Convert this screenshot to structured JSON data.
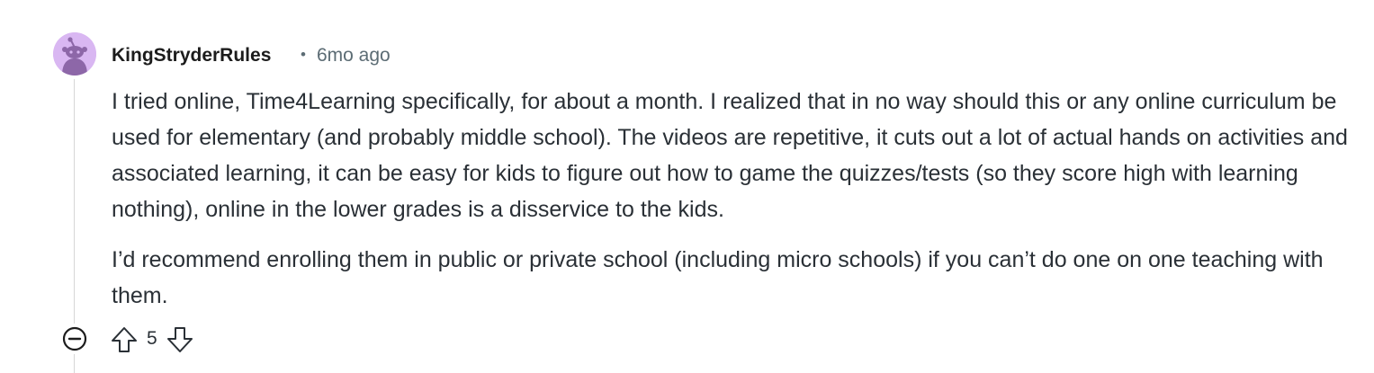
{
  "comment": {
    "author": "KingStryderRules",
    "separator": "•",
    "timestamp": "6mo ago",
    "paragraphs": [
      "I tried online, Time4Learning specifically, for about a month. I realized that in no way should this or any online curriculum be used for elementary (and probably middle school). The videos are repetitive, it cuts out a lot of actual hands on activities and associated learning, it can be easy for kids to figure out how to game the quizzes/tests (so they score high with learning nothing), online in the lower grades is a disservice to the kids.",
      "I’d recommend enrolling them in public or private school (including micro schools) if you can’t do one on one teaching with them."
    ],
    "score": "5",
    "icons": {
      "avatar": "snoo-avatar-icon",
      "collapse": "collapse-minus-icon",
      "upvote": "upvote-arrow-icon",
      "downvote": "downvote-arrow-icon"
    },
    "colors": {
      "avatar_bg": "#d9b7f2",
      "avatar_figure": "#8d67a8",
      "meta_text": "#5c6c74",
      "body_text": "#2a3036"
    }
  }
}
